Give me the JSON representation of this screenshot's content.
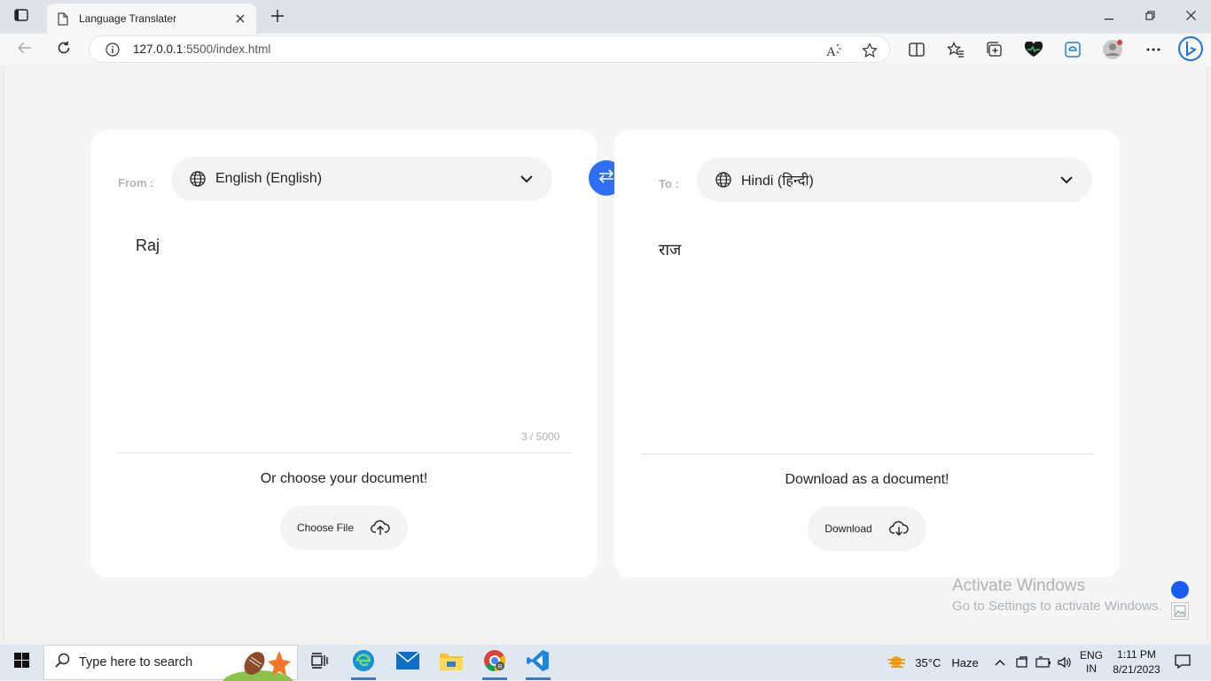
{
  "browser": {
    "tab_title": "Language Translater",
    "url_host": "127.0.0.1",
    "url_path": ":5500/index.html"
  },
  "translator": {
    "from_label": "From :",
    "to_label": "To :",
    "from_language": "English (English)",
    "to_language": "Hindi (हिन्दी)",
    "input_text": "Raj",
    "output_text": "राज",
    "char_counter": "3 / 5000",
    "choose_doc_text": "Or choose your document!",
    "choose_file_label": "Choose File",
    "download_doc_text": "Download as a document!",
    "download_label": "Download"
  },
  "watermark": {
    "line1": "Activate Windows",
    "line2": "Go to Settings to activate Windows."
  },
  "taskbar": {
    "search_placeholder": "Type here to search",
    "weather_temp": "35°C",
    "weather_desc": "Haze",
    "lang_line1": "ENG",
    "lang_line2": "IN",
    "time": "1:11 PM",
    "date": "8/21/2023"
  },
  "colors": {
    "accent": "#2e6ff2",
    "card_bg": "#ffffff",
    "page_bg": "#f5f5f5",
    "pill_bg": "#f3f3f3"
  },
  "icons": [
    "tab-actions-icon",
    "page-icon",
    "close-icon",
    "plus-icon",
    "minimize-icon",
    "restore-icon",
    "window-close-icon",
    "back-icon",
    "refresh-icon",
    "info-icon",
    "read-aloud-icon",
    "star-icon",
    "split-screen-icon",
    "favorites-icon",
    "collections-icon",
    "heart-icon",
    "edge-icon",
    "profile-icon",
    "more-icon",
    "bing-icon",
    "globe-icon",
    "chevron-down-icon",
    "swap-icon",
    "upload-cloud-icon",
    "download-cloud-icon",
    "windows-icon",
    "search-icon",
    "task-view-icon",
    "edge-taskbar-icon",
    "mail-icon",
    "file-explorer-icon",
    "chrome-icon",
    "vscode-icon",
    "weather-icon",
    "tray-chevron-icon",
    "network-icon",
    "battery-icon",
    "volume-icon",
    "notification-icon"
  ]
}
